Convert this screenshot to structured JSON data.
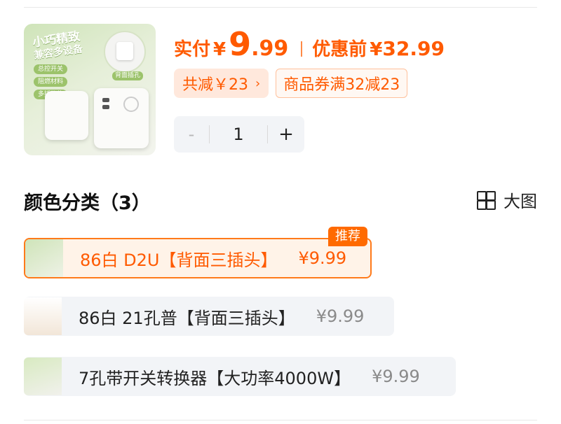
{
  "product": {
    "thumbnail": {
      "title": "小巧精致",
      "subtitle": "兼容多设备",
      "features": [
        "总控开关",
        "阻燃材料",
        "多插孔位"
      ],
      "plug_tag": "背面插孔",
      "icon": "power-strip-image"
    },
    "price": {
      "label": "实付",
      "currency": "¥",
      "integer": "9",
      "decimal": ".99",
      "original_label": "优惠前",
      "original_currency": "¥",
      "original_value": "32.99"
    },
    "discount_tag": "共减￥23",
    "discount_chevron": "›",
    "coupon_tag": "商品券满32减23",
    "quantity": {
      "minus": "-",
      "value": "1",
      "plus": "+"
    }
  },
  "section": {
    "title": "颜色分类（3）",
    "view_toggle": {
      "icon": "grid-icon",
      "label": "大图"
    }
  },
  "options": [
    {
      "name": "86白 D2U【背面三插头】",
      "price": "¥9.99",
      "selected": true,
      "badge": "推荐"
    },
    {
      "name": "86白 21孔普【背面三插头】",
      "price": "¥9.99",
      "selected": false
    },
    {
      "name": "7孔带开关转换器【大功率4000W】",
      "price": "¥9.99",
      "selected": false
    }
  ],
  "colors": {
    "accent": "#ff5a00",
    "accent_light": "#ffe8dc",
    "option_bg": "#f2f4f7",
    "badge_bg": "#ff6a00"
  }
}
